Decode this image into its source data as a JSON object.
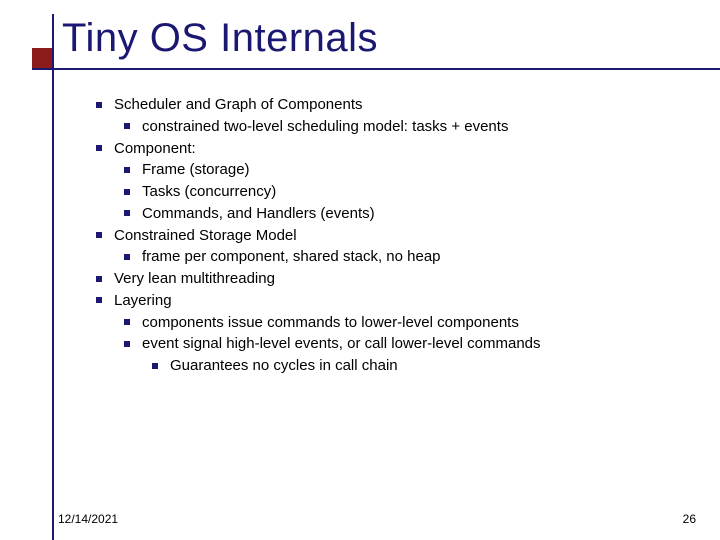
{
  "title": "Tiny OS Internals",
  "bullets": {
    "b0": "Scheduler and Graph of Components",
    "b0_0": "constrained two-level scheduling model: tasks + events",
    "b1": "Component:",
    "b1_0": "Frame (storage)",
    "b1_1": "Tasks (concurrency)",
    "b1_2": "Commands, and Handlers (events)",
    "b2": "Constrained Storage Model",
    "b2_0": "frame per component, shared stack, no heap",
    "b3": "Very lean multithreading",
    "b4": "Layering",
    "b4_0": "components issue commands to lower-level components",
    "b4_1": "event signal high-level events, or call lower-level commands",
    "b4_1_0": "Guarantees no cycles in call chain"
  },
  "footer": {
    "date": "12/14/2021",
    "page": "26"
  }
}
